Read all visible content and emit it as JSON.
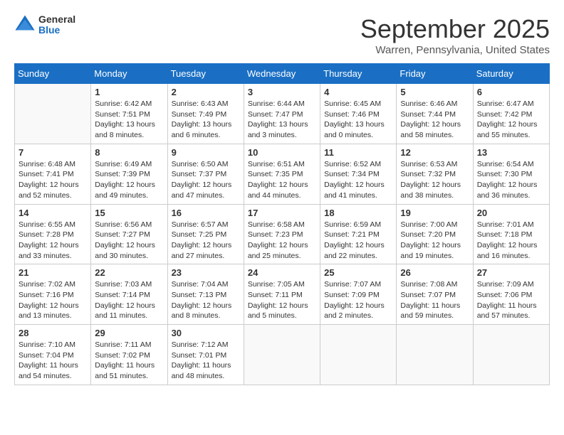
{
  "header": {
    "logo": {
      "general": "General",
      "blue": "Blue"
    },
    "month": "September 2025",
    "location": "Warren, Pennsylvania, United States"
  },
  "weekdays": [
    "Sunday",
    "Monday",
    "Tuesday",
    "Wednesday",
    "Thursday",
    "Friday",
    "Saturday"
  ],
  "weeks": [
    [
      {
        "day": null
      },
      {
        "day": 1,
        "sunrise": "6:42 AM",
        "sunset": "7:51 PM",
        "daylight": "13 hours and 8 minutes."
      },
      {
        "day": 2,
        "sunrise": "6:43 AM",
        "sunset": "7:49 PM",
        "daylight": "13 hours and 6 minutes."
      },
      {
        "day": 3,
        "sunrise": "6:44 AM",
        "sunset": "7:47 PM",
        "daylight": "13 hours and 3 minutes."
      },
      {
        "day": 4,
        "sunrise": "6:45 AM",
        "sunset": "7:46 PM",
        "daylight": "13 hours and 0 minutes."
      },
      {
        "day": 5,
        "sunrise": "6:46 AM",
        "sunset": "7:44 PM",
        "daylight": "12 hours and 58 minutes."
      },
      {
        "day": 6,
        "sunrise": "6:47 AM",
        "sunset": "7:42 PM",
        "daylight": "12 hours and 55 minutes."
      }
    ],
    [
      {
        "day": 7,
        "sunrise": "6:48 AM",
        "sunset": "7:41 PM",
        "daylight": "12 hours and 52 minutes."
      },
      {
        "day": 8,
        "sunrise": "6:49 AM",
        "sunset": "7:39 PM",
        "daylight": "12 hours and 49 minutes."
      },
      {
        "day": 9,
        "sunrise": "6:50 AM",
        "sunset": "7:37 PM",
        "daylight": "12 hours and 47 minutes."
      },
      {
        "day": 10,
        "sunrise": "6:51 AM",
        "sunset": "7:35 PM",
        "daylight": "12 hours and 44 minutes."
      },
      {
        "day": 11,
        "sunrise": "6:52 AM",
        "sunset": "7:34 PM",
        "daylight": "12 hours and 41 minutes."
      },
      {
        "day": 12,
        "sunrise": "6:53 AM",
        "sunset": "7:32 PM",
        "daylight": "12 hours and 38 minutes."
      },
      {
        "day": 13,
        "sunrise": "6:54 AM",
        "sunset": "7:30 PM",
        "daylight": "12 hours and 36 minutes."
      }
    ],
    [
      {
        "day": 14,
        "sunrise": "6:55 AM",
        "sunset": "7:28 PM",
        "daylight": "12 hours and 33 minutes."
      },
      {
        "day": 15,
        "sunrise": "6:56 AM",
        "sunset": "7:27 PM",
        "daylight": "12 hours and 30 minutes."
      },
      {
        "day": 16,
        "sunrise": "6:57 AM",
        "sunset": "7:25 PM",
        "daylight": "12 hours and 27 minutes."
      },
      {
        "day": 17,
        "sunrise": "6:58 AM",
        "sunset": "7:23 PM",
        "daylight": "12 hours and 25 minutes."
      },
      {
        "day": 18,
        "sunrise": "6:59 AM",
        "sunset": "7:21 PM",
        "daylight": "12 hours and 22 minutes."
      },
      {
        "day": 19,
        "sunrise": "7:00 AM",
        "sunset": "7:20 PM",
        "daylight": "12 hours and 19 minutes."
      },
      {
        "day": 20,
        "sunrise": "7:01 AM",
        "sunset": "7:18 PM",
        "daylight": "12 hours and 16 minutes."
      }
    ],
    [
      {
        "day": 21,
        "sunrise": "7:02 AM",
        "sunset": "7:16 PM",
        "daylight": "12 hours and 13 minutes."
      },
      {
        "day": 22,
        "sunrise": "7:03 AM",
        "sunset": "7:14 PM",
        "daylight": "12 hours and 11 minutes."
      },
      {
        "day": 23,
        "sunrise": "7:04 AM",
        "sunset": "7:13 PM",
        "daylight": "12 hours and 8 minutes."
      },
      {
        "day": 24,
        "sunrise": "7:05 AM",
        "sunset": "7:11 PM",
        "daylight": "12 hours and 5 minutes."
      },
      {
        "day": 25,
        "sunrise": "7:07 AM",
        "sunset": "7:09 PM",
        "daylight": "12 hours and 2 minutes."
      },
      {
        "day": 26,
        "sunrise": "7:08 AM",
        "sunset": "7:07 PM",
        "daylight": "11 hours and 59 minutes."
      },
      {
        "day": 27,
        "sunrise": "7:09 AM",
        "sunset": "7:06 PM",
        "daylight": "11 hours and 57 minutes."
      }
    ],
    [
      {
        "day": 28,
        "sunrise": "7:10 AM",
        "sunset": "7:04 PM",
        "daylight": "11 hours and 54 minutes."
      },
      {
        "day": 29,
        "sunrise": "7:11 AM",
        "sunset": "7:02 PM",
        "daylight": "11 hours and 51 minutes."
      },
      {
        "day": 30,
        "sunrise": "7:12 AM",
        "sunset": "7:01 PM",
        "daylight": "11 hours and 48 minutes."
      },
      {
        "day": null
      },
      {
        "day": null
      },
      {
        "day": null
      },
      {
        "day": null
      }
    ]
  ]
}
